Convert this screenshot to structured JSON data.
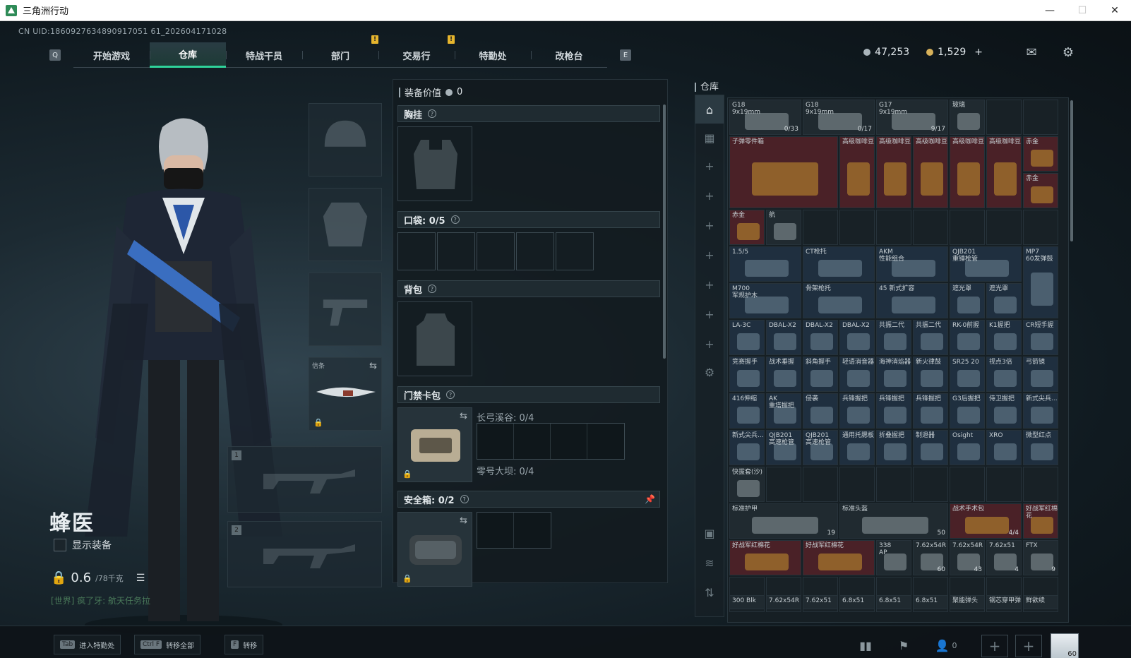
{
  "window": {
    "title": "三角洲行动",
    "min": "—",
    "max": "☐",
    "close": "✕"
  },
  "uid": "CN UID:1860927634890917051 61_202604171028",
  "nav": {
    "left_key": "Q",
    "right_key": "E",
    "tabs": [
      {
        "label": "开始游戏"
      },
      {
        "label": "仓库"
      },
      {
        "label": "特战干员"
      },
      {
        "label": "部门"
      },
      {
        "label": "交易行"
      },
      {
        "label": "特勤处"
      },
      {
        "label": "改枪台"
      }
    ],
    "badge": "!"
  },
  "currency": {
    "silver": "47,253",
    "gold": "1,529",
    "plus": "+"
  },
  "operator": {
    "name": "蜂医",
    "show_equip": "显示装备",
    "weight": "0.6",
    "weight_max": "/78千克",
    "chat": "[世界] 疯了牙: 航天任务拉"
  },
  "equip": {
    "melee_label": "信条",
    "gun1": "1",
    "gun2": "2"
  },
  "mid": {
    "equip_value_label": "装备价值",
    "equip_value": "0",
    "chest": "胸挂",
    "pocket": "口袋: 0/5",
    "backpack": "背包",
    "keycard": "门禁卡包",
    "keycard_a": "长弓溪谷: 0/4",
    "keycard_b": "零号大坝: 0/4",
    "safe": "安全箱: 0/2",
    "q": "?"
  },
  "warehouse": {
    "title": "仓库",
    "items": [
      {
        "name": "G18\n9x19mm",
        "count": "0/33",
        "rarity": "gray"
      },
      {
        "name": "G18\n9x19mm",
        "count": "0/17",
        "rarity": "gray"
      },
      {
        "name": "G17\n9x19mm",
        "count": "9/17",
        "rarity": "gray"
      },
      {
        "name": "玻璃",
        "count": "",
        "rarity": "gray"
      },
      {
        "name": "子弹零件箱",
        "count": "",
        "rarity": "red"
      },
      {
        "name": "高级咖啡豆",
        "count": "",
        "rarity": "red"
      },
      {
        "name": "高级咖啡豆",
        "count": "",
        "rarity": "red"
      },
      {
        "name": "高级咖啡豆",
        "count": "",
        "rarity": "red"
      },
      {
        "name": "高级咖啡豆",
        "count": "",
        "rarity": "red"
      },
      {
        "name": "高级咖啡豆",
        "count": "",
        "rarity": "red"
      },
      {
        "name": "赤金",
        "count": "",
        "rarity": "red"
      },
      {
        "name": "赤金",
        "count": "",
        "rarity": "red"
      },
      {
        "name": "赤金",
        "count": "",
        "rarity": "red"
      },
      {
        "name": "航",
        "count": "",
        "rarity": "gray"
      },
      {
        "name": "1.5/5",
        "count": "",
        "rarity": "blue"
      },
      {
        "name": "CT枪托",
        "count": "",
        "rarity": "blue"
      },
      {
        "name": "AKM\n性能组合",
        "count": "",
        "rarity": "blue"
      },
      {
        "name": "QJB201\n重锤枪管",
        "count": "",
        "rarity": "blue"
      },
      {
        "name": "MP7\n60发弹鼓",
        "count": "",
        "rarity": "blue"
      },
      {
        "name": "M700\n军规护木",
        "count": "",
        "rarity": "blue"
      },
      {
        "name": "骨架枪托",
        "count": "",
        "rarity": "blue"
      },
      {
        "name": "45 新式扩容",
        "count": "",
        "rarity": "blue"
      },
      {
        "name": "遮光罩",
        "count": "",
        "rarity": "blue"
      },
      {
        "name": "遮光罩",
        "count": "",
        "rarity": "blue"
      },
      {
        "name": "LA-3C",
        "count": "",
        "rarity": "blue"
      },
      {
        "name": "DBAL-X2",
        "count": "",
        "rarity": "blue"
      },
      {
        "name": "DBAL-X2",
        "count": "",
        "rarity": "blue"
      },
      {
        "name": "DBAL-X2",
        "count": "",
        "rarity": "blue"
      },
      {
        "name": "共振二代",
        "count": "",
        "rarity": "blue"
      },
      {
        "name": "共振二代",
        "count": "",
        "rarity": "blue"
      },
      {
        "name": "RK-0前握",
        "count": "",
        "rarity": "blue"
      },
      {
        "name": "K1握把",
        "count": "",
        "rarity": "blue"
      },
      {
        "name": "CR短手握",
        "count": "",
        "rarity": "blue"
      },
      {
        "name": "竞赛握手",
        "count": "",
        "rarity": "blue"
      },
      {
        "name": "战术垂握",
        "count": "",
        "rarity": "blue"
      },
      {
        "name": "斜角握手",
        "count": "",
        "rarity": "blue"
      },
      {
        "name": "轻语消音器",
        "count": "",
        "rarity": "blue"
      },
      {
        "name": "海神消焰器",
        "count": "",
        "rarity": "blue"
      },
      {
        "name": "新火律鼓",
        "count": "",
        "rarity": "blue"
      },
      {
        "name": "SR25 20",
        "count": "",
        "rarity": "blue"
      },
      {
        "name": "视点3倍",
        "count": "",
        "rarity": "blue"
      },
      {
        "name": "弓箭镜",
        "count": "",
        "rarity": "blue"
      },
      {
        "name": "416伸缩",
        "count": "",
        "rarity": "blue"
      },
      {
        "name": "AK\n重塔握把",
        "count": "",
        "rarity": "blue"
      },
      {
        "name": "侵袭",
        "count": "",
        "rarity": "blue"
      },
      {
        "name": "兵锋握把",
        "count": "",
        "rarity": "blue"
      },
      {
        "name": "兵锋握把",
        "count": "",
        "rarity": "blue"
      },
      {
        "name": "兵锋握把",
        "count": "",
        "rarity": "blue"
      },
      {
        "name": "G3后握把",
        "count": "",
        "rarity": "blue"
      },
      {
        "name": "侍卫握把",
        "count": "",
        "rarity": "blue"
      },
      {
        "name": "新式尖兵...",
        "count": "",
        "rarity": "blue"
      },
      {
        "name": "新式尖兵...",
        "count": "",
        "rarity": "blue"
      },
      {
        "name": "QJB201\n高速枪管",
        "count": "",
        "rarity": "blue"
      },
      {
        "name": "QJB201\n高速枪管",
        "count": "",
        "rarity": "blue"
      },
      {
        "name": "通用托腮板",
        "count": "",
        "rarity": "blue"
      },
      {
        "name": "折叠握把",
        "count": "",
        "rarity": "blue"
      },
      {
        "name": "制退器",
        "count": "",
        "rarity": "blue"
      },
      {
        "name": "Osight",
        "count": "",
        "rarity": "blue"
      },
      {
        "name": "XRO",
        "count": "",
        "rarity": "blue"
      },
      {
        "name": "微型红点",
        "count": "",
        "rarity": "blue"
      },
      {
        "name": "快拔套(沙)",
        "count": "",
        "rarity": "gray"
      },
      {
        "name": "标准护甲",
        "count": "19",
        "rarity": "gray"
      },
      {
        "name": "标准头盔",
        "count": "50",
        "rarity": "gray"
      },
      {
        "name": "战术手术包",
        "count": "4/4",
        "rarity": "red"
      },
      {
        "name": "好战军红棉花",
        "count": "",
        "rarity": "red"
      },
      {
        "name": "好战军红棉花",
        "count": "",
        "rarity": "red"
      },
      {
        "name": "好战军红棉花",
        "count": "",
        "rarity": "red"
      },
      {
        "name": "338\nAP",
        "count": "",
        "rarity": "gray"
      },
      {
        "name": "7.62x54R",
        "count": "60",
        "rarity": "gray"
      },
      {
        "name": "7.62x54R",
        "count": "43",
        "rarity": "gray"
      },
      {
        "name": "7.62x51",
        "count": "4",
        "rarity": "gray"
      },
      {
        "name": "FTX",
        "count": "9",
        "rarity": "gray"
      }
    ],
    "bottom_row": [
      "300 Blk",
      "7.62x54R",
      "7.62x51",
      "6.8x51",
      "6.8x51",
      "6.8x51",
      "聚能弹头",
      "钢芯穿甲弹",
      "鲜欲续"
    ]
  },
  "bottom": {
    "hints": [
      {
        "key": "Tab",
        "label": "进入特勤处"
      },
      {
        "key": "Ctrl F",
        "label": "转移全部"
      },
      {
        "key": "F",
        "label": "转移"
      }
    ],
    "friends": "0",
    "avatar_level": "60"
  }
}
